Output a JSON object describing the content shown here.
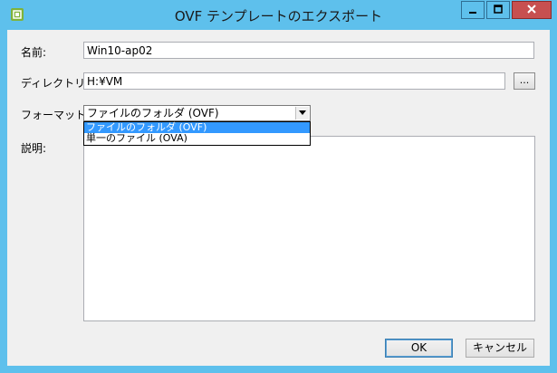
{
  "window": {
    "title": "OVF テンプレートのエクスポート",
    "icon": "vsphere-client-icon",
    "accent_color": "#5ec0ec",
    "close_color": "#c75050"
  },
  "form": {
    "name_label": "名前:",
    "name_value": "Win10-ap02",
    "directory_label": "ディレクトリ:",
    "directory_value": "H:¥VM",
    "browse_label": "...",
    "format_label": "フォーマット:",
    "format_selected": "ファイルのフォルダ (OVF)",
    "format_options": [
      "ファイルのフォルダ (OVF)",
      "単一のファイル (OVA)"
    ],
    "description_label": "説明:"
  },
  "buttons": {
    "ok": "OK",
    "cancel": "キャンセル"
  }
}
